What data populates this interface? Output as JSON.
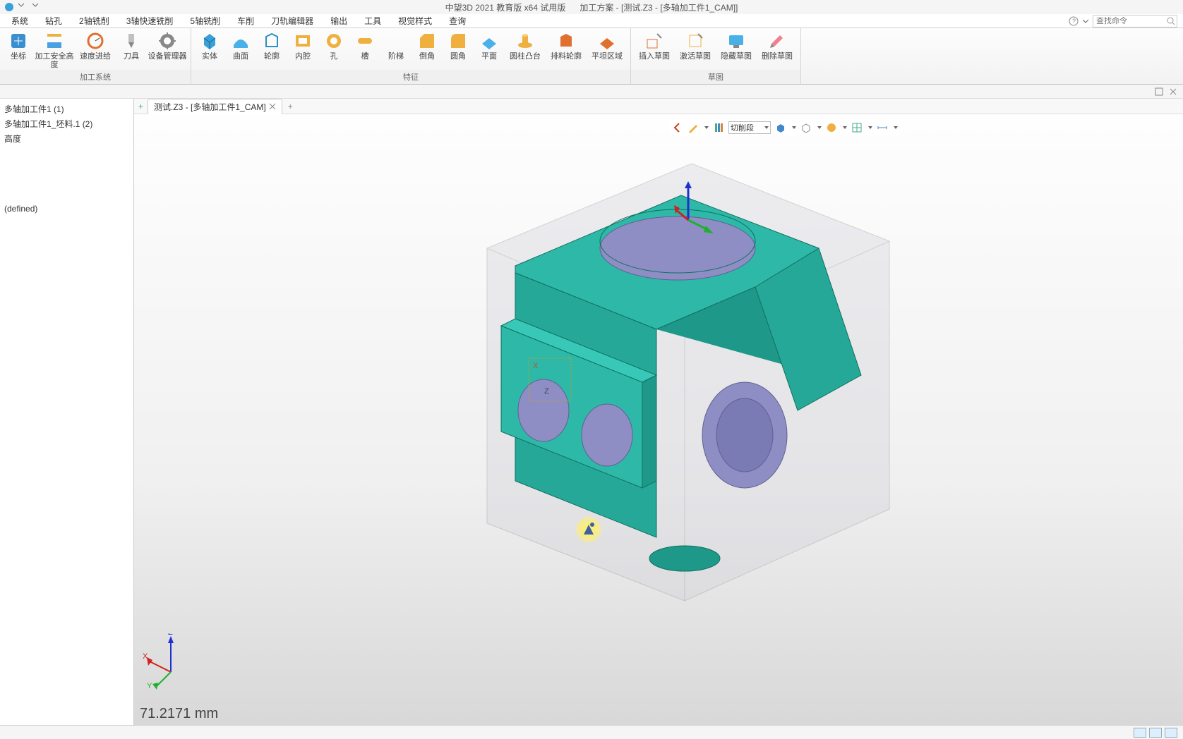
{
  "app": {
    "title_left": "中望3D 2021 教育版 x64 试用版",
    "title_mid": "加工方案 -",
    "title_file": "[测试.Z3 - [多轴加工件1_CAM]]"
  },
  "menu": {
    "items": [
      "系统",
      "钻孔",
      "2轴铣削",
      "3轴快速铣削",
      "5轴铣削",
      "车削",
      "刀轨编辑器",
      "输出",
      "工具",
      "视觉样式",
      "查询"
    ],
    "search_placeholder": "查找命令"
  },
  "ribbon": {
    "group_machining": {
      "buttons": [
        "坐标",
        "加工安全高度",
        "速度进给",
        "刀具",
        "设备管理器"
      ],
      "label": "加工系统"
    },
    "group_feature": {
      "buttons": [
        "实体",
        "曲面",
        "轮廓",
        "内腔",
        "孔",
        "槽",
        "阶梯",
        "倒角",
        "圆角",
        "平面",
        "圆柱凸台",
        "排料轮廓",
        "平坦区域"
      ],
      "label": "特征"
    },
    "group_sketch": {
      "buttons": [
        "插入草图",
        "激活草图",
        "隐藏草图",
        "删除草图"
      ],
      "label": "草图"
    }
  },
  "tabs": {
    "active": "测试.Z3 - [多轴加工件1_CAM]",
    "add_symbol": "+"
  },
  "tree": {
    "items": [
      "多轴加工件1 (1)",
      "多轴加工件1_坯料.1 (2)",
      "高度",
      "",
      "",
      "",
      "",
      "(defined)"
    ]
  },
  "float_toolbar": {
    "dropdown_value": "切削段"
  },
  "viewport": {
    "readout": "71.2171 mm",
    "axes": {
      "x": "X",
      "y": "Y",
      "z": "Z"
    },
    "model_accent": "#2eb8a8",
    "model_shade": "#8e8ec5",
    "stock_color": "#c9c9c9aa"
  },
  "status": {
    "view_buttons": [
      "1",
      "2",
      "3"
    ]
  }
}
